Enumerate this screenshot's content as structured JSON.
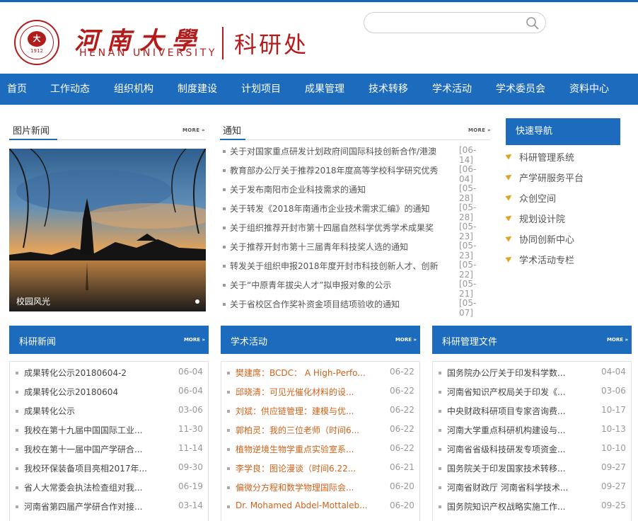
{
  "header": {
    "seal_mark": "大",
    "seal_year": "1912",
    "university_cn": "河南大學",
    "university_en": "HENAN UNIVERSITY",
    "department": "科研处",
    "search_placeholder": ""
  },
  "nav": [
    "首页",
    "工作动态",
    "组织机构",
    "制度建设",
    "计划项目",
    "成果管理",
    "技术转移",
    "学术活动",
    "学术委员会",
    "资料中心"
  ],
  "photo_news": {
    "title": "图片新闻",
    "more": "MORE",
    "caption": "校园风光"
  },
  "notices": {
    "title": "通知",
    "more": "MORE",
    "items": [
      {
        "text": "关于对国家重点研发计划政府间国际科技创新合作/港澳",
        "date": "[06-14]"
      },
      {
        "text": "教育部办公厅关于推荐2018年度高等学校科学研究优秀",
        "date": "[06-04]"
      },
      {
        "text": "关于发布南阳市企业科技需求的通知",
        "date": "[05-28]"
      },
      {
        "text": "关于转发《2018年南通市企业技术需求汇编》的通知",
        "date": "[05-28]"
      },
      {
        "text": "关于组织推荐开封市第十四届自然科学优秀学术成果奖",
        "date": "[05-23]"
      },
      {
        "text": "关于推荐开封市第十三届青年科技奖人选的通知",
        "date": "[05-23]"
      },
      {
        "text": "转发关于组织申报2018年度开封市科技创新人才、创新",
        "date": "[05-22]"
      },
      {
        "text": "关于“中原青年拔尖人才”拟申报对象的公示",
        "date": "[05-21]"
      },
      {
        "text": "关于省校区合作奖补资金项目结项验收的通知",
        "date": "[05-07]"
      }
    ]
  },
  "quick_nav": {
    "title": "快速导航",
    "items": [
      "科研管理系统",
      "产学研服务平台",
      "众创空间",
      "规划设计院",
      "协同创新中心",
      "学术活动专栏"
    ]
  },
  "research_news": {
    "title": "科研新闻",
    "more": "MORE",
    "items": [
      {
        "text": "成果转化公示20180604-2",
        "date": "06-04"
      },
      {
        "text": "成果转化公示20180604",
        "date": "06-04"
      },
      {
        "text": "成果转化公示",
        "date": "03-06"
      },
      {
        "text": "我校在第十九届中国国际工业...",
        "date": "11-30"
      },
      {
        "text": "我校在第十一届中国产学研合...",
        "date": "11-14"
      },
      {
        "text": "我校环保装备项目亮相2017年...",
        "date": "09-30"
      },
      {
        "text": "省人大常委会执法检查组对我...",
        "date": "06-19"
      },
      {
        "text": "河南省第四届产学研合作对接...",
        "date": "03-14"
      }
    ]
  },
  "academic": {
    "title": "学术活动",
    "more": "MORE",
    "items": [
      {
        "text": "樊建席：BCDC： A High-Perfo...",
        "date": "06-22"
      },
      {
        "text": "邱晓清：可见光催化材料的设...",
        "date": "06-22"
      },
      {
        "text": "刘斌：供应链管理：建模与优...",
        "date": "06-22"
      },
      {
        "text": "郭柏灵：我的三位老师（时间6...",
        "date": "06-22"
      },
      {
        "text": "植物逆境生物学重点实验室系...",
        "date": "06-22"
      },
      {
        "text": "李学良：图论漫谈（时间6.22...",
        "date": "06-21"
      },
      {
        "text": "偏微分方程和数学物理国际会...",
        "date": "06-20"
      },
      {
        "text": "Dr. Mohamed Abdel-Mottaleb...",
        "date": "06-20"
      }
    ]
  },
  "documents": {
    "title": "科研管理文件",
    "more": "MORE",
    "items": [
      {
        "text": "国务院办公厅关于印发科学数...",
        "date": "04-04"
      },
      {
        "text": "河南省知识产权局关于印发《...",
        "date": "03-06"
      },
      {
        "text": "中央财政科研项目专家咨询费...",
        "date": "10-17"
      },
      {
        "text": "河南大学重点科研机构建设与...",
        "date": "10-13"
      },
      {
        "text": "河南省省级科技研发专项资金...",
        "date": "10-10"
      },
      {
        "text": "国务院关于印发国家技术转移...",
        "date": "09-27"
      },
      {
        "text": "河南省财政厅 河南省科学技术...",
        "date": "09-27"
      },
      {
        "text": "国务院知识产权战略实施工作...",
        "date": "09-25"
      }
    ]
  },
  "colors": {
    "brand_blue": "#1d6bbd",
    "brand_red": "#b41c1c",
    "accent_orange": "#e1a323"
  }
}
